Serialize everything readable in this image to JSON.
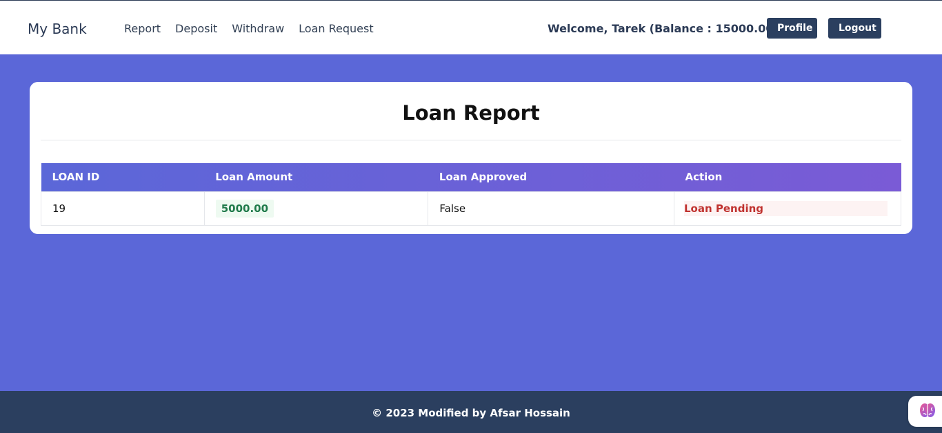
{
  "navbar": {
    "brand": "My Bank",
    "links": [
      {
        "label": "Report"
      },
      {
        "label": "Deposit"
      },
      {
        "label": "Withdraw"
      },
      {
        "label": "Loan Request"
      }
    ],
    "welcome": "Welcome, Tarek (Balance : 15000.00)",
    "profile_label": "Profile",
    "logout_label": "Logout"
  },
  "report": {
    "title": "Loan Report",
    "columns": [
      "LOAN ID",
      "Loan Amount",
      "Loan Approved",
      "Action"
    ],
    "rows": [
      {
        "loan_id": "19",
        "amount": "5000.00",
        "approved": "False",
        "action": "Loan Pending"
      }
    ]
  },
  "footer": {
    "text": "© 2023 Modified by Afsar Hossain"
  },
  "widget": {
    "icon": "brain-icon"
  },
  "colors": {
    "background": "#5b67d8",
    "navbar_button": "#2b3f5f",
    "header_gradient_start": "#5b67d8",
    "header_gradient_end": "#7a5bd6",
    "amount_green": "#1f7a4a",
    "pending_red": "#c0322f"
  }
}
